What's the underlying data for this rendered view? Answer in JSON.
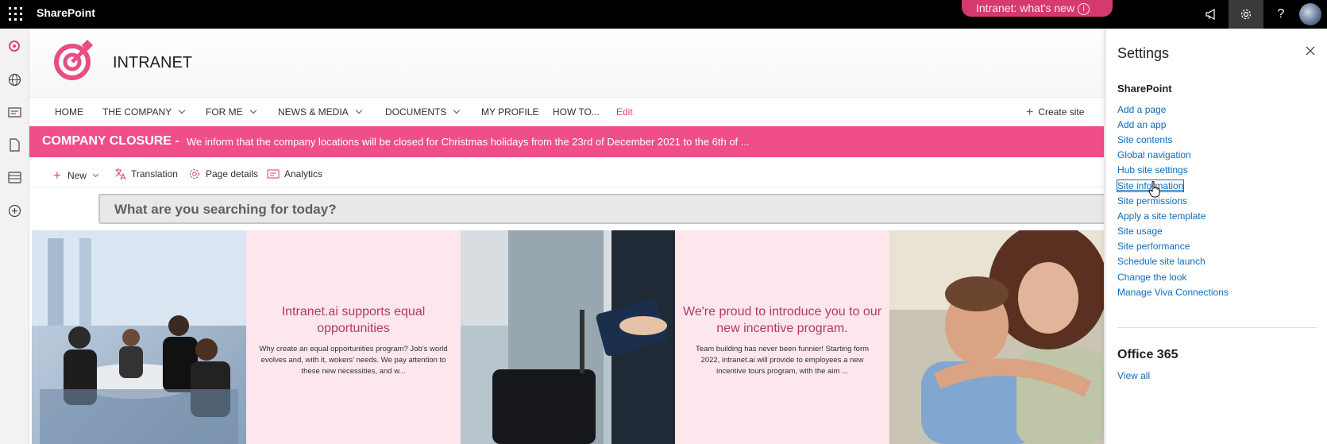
{
  "suite": {
    "brand": "SharePoint",
    "whats_new": "Intranet: what's new",
    "whats_new_icon": "info-icon",
    "icons": [
      "waffle-icon",
      "megaphone-icon",
      "settings-gear-icon",
      "help-icon",
      "avatar"
    ]
  },
  "rail": {
    "icons": [
      "home-target-icon",
      "globe-icon",
      "news-icon",
      "document-icon",
      "list-icon",
      "add-circle-icon"
    ]
  },
  "site": {
    "title": "INTRANET"
  },
  "nav": {
    "items": [
      {
        "label": "HOME",
        "dropdown": false
      },
      {
        "label": "THE COMPANY",
        "dropdown": true
      },
      {
        "label": "FOR ME",
        "dropdown": true
      },
      {
        "label": "NEWS & MEDIA",
        "dropdown": true
      },
      {
        "label": "DOCUMENTS",
        "dropdown": true
      },
      {
        "label": "MY PROFILE",
        "dropdown": false
      },
      {
        "label": "HOW TO...",
        "dropdown": false
      }
    ],
    "edit": "Edit",
    "create_site": "Create site"
  },
  "banner": {
    "label": "COMPANY CLOSURE -",
    "message": "We inform that the company locations will be closed for Christmas holidays from the 23rd of December 2021 to the 6th of ...",
    "color": "#f04e89"
  },
  "commands": {
    "new": "New",
    "translation": "Translation",
    "page_details": "Page details",
    "analytics": "Analytics"
  },
  "search": {
    "placeholder": "What are you searching for today?"
  },
  "tiles": [
    {
      "kind": "image",
      "alt": "team-meeting-photo"
    },
    {
      "kind": "text",
      "title": "Intranet.ai supports equal opportunities",
      "text": "Why create an equal opportunities program? Job's world evolves and, with it, wokers' needs. We pay attention to these new necessities, and w..."
    },
    {
      "kind": "image",
      "alt": "traveler-luggage-photo"
    },
    {
      "kind": "text",
      "title": "We're proud to introduce you to our new incentive program.",
      "text": "Team building has never been funnier! Starting form 2022, intranet.ai will provide to employees a new incentive tours program, with the aim ..."
    },
    {
      "kind": "image",
      "alt": "happy-couple-photo"
    }
  ],
  "settings": {
    "title": "Settings",
    "sharepoint_heading": "SharePoint",
    "links": [
      "Add a page",
      "Add an app",
      "Site contents",
      "Global navigation",
      "Hub site settings",
      "Site information",
      "Site permissions",
      "Apply a site template",
      "Site usage",
      "Site performance",
      "Schedule site launch",
      "Change the look",
      "Manage Viva Connections"
    ],
    "focused_link": "Site information",
    "office_heading": "Office 365",
    "view_all": "View all"
  },
  "colors": {
    "accent": "#e0457b",
    "link": "#0f6cbd",
    "tile_pink": "#fde6ec",
    "tile_title": "#b3396a"
  }
}
